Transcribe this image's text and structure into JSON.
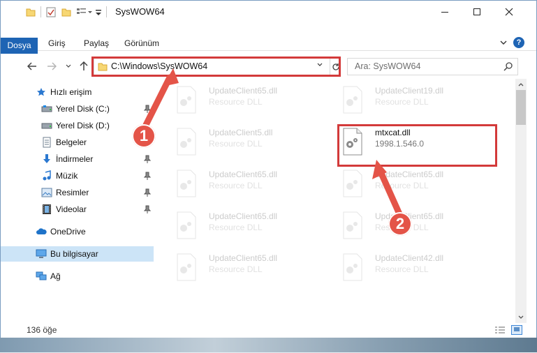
{
  "window": {
    "title": "SysWOW64"
  },
  "ribbon": {
    "tabs": [
      "Dosya",
      "Giriş",
      "Paylaş",
      "Görünüm"
    ]
  },
  "address": {
    "path": "C:\\Windows\\SysWOW64"
  },
  "search": {
    "placeholder": "Ara: SysWOW64"
  },
  "sidebar": {
    "items": [
      {
        "label": "Hızlı erişim"
      },
      {
        "label": "Yerel Disk (C:)"
      },
      {
        "label": "Yerel Disk (D:)"
      },
      {
        "label": "Belgeler"
      },
      {
        "label": "İndirmeler"
      },
      {
        "label": "Müzik"
      },
      {
        "label": "Resimler"
      },
      {
        "label": "Videolar"
      },
      {
        "label": "OneDrive"
      },
      {
        "label": "Bu bilgisayar"
      },
      {
        "label": "Ağ"
      }
    ]
  },
  "files": [
    {
      "name": "UpdateClient65.dll",
      "sub": "Resource DLL"
    },
    {
      "name": "UpdateClient19.dll",
      "sub": "Resource DLL"
    },
    {
      "name": "UpdateClient5.dll",
      "sub": "Resource DLL"
    },
    {
      "name": "mtxcat.dll",
      "sub": "1998.1.546.0"
    },
    {
      "name": "UpdateClient65.dll",
      "sub": "Resource DLL"
    },
    {
      "name": "UpdateClient65.dll",
      "sub": "Resource DLL"
    },
    {
      "name": "UpdateClient65.dll",
      "sub": "Resource DLL"
    },
    {
      "name": "UpdateClient65.dll",
      "sub": "Resource DLL"
    },
    {
      "name": "UpdateClient65.dll",
      "sub": "Resource DLL"
    },
    {
      "name": "UpdateClient42.dll",
      "sub": "Resource DLL"
    }
  ],
  "status": {
    "count": "136 öğe"
  },
  "annotations": {
    "badge1": "1",
    "badge2": "2"
  },
  "colors": {
    "ribbon_file_tab": "#1e64b4",
    "highlight": "#d33a3a",
    "badge": "#e45448",
    "selected": "#cce4f7"
  }
}
